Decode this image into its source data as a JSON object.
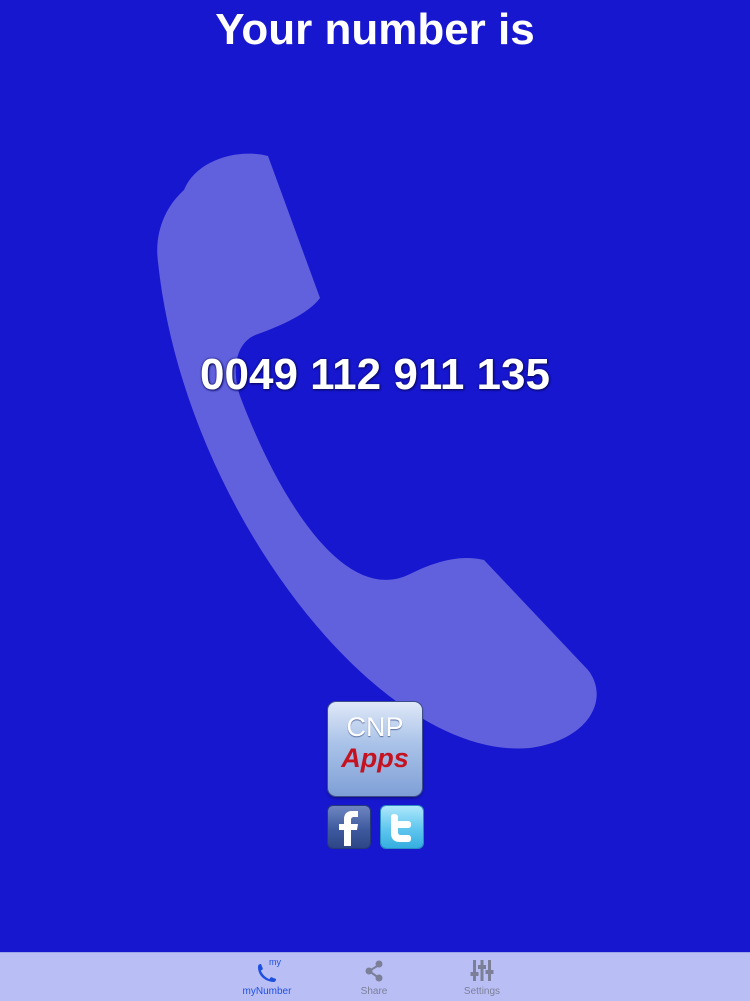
{
  "header": {
    "title": "Your number is"
  },
  "main": {
    "phone_number": "0049 112 911 135",
    "background_icon": "phone-handset-icon"
  },
  "brand": {
    "logo_line1": "CNP",
    "logo_line2": "Apps",
    "social": [
      {
        "name": "facebook-icon"
      },
      {
        "name": "twitter-icon"
      }
    ]
  },
  "tabbar": {
    "tabs": [
      {
        "label": "myNumber",
        "icon": "phone-icon",
        "badge": "my",
        "active": true
      },
      {
        "label": "Share",
        "icon": "share-icon",
        "active": false
      },
      {
        "label": "Settings",
        "icon": "sliders-icon",
        "active": false
      }
    ]
  },
  "colors": {
    "background": "#1717cf",
    "tabbar": "#b9bff5",
    "active_tab": "#1f4fe0",
    "inactive_tab": "#7b7f98",
    "brand_red": "#c41220"
  }
}
